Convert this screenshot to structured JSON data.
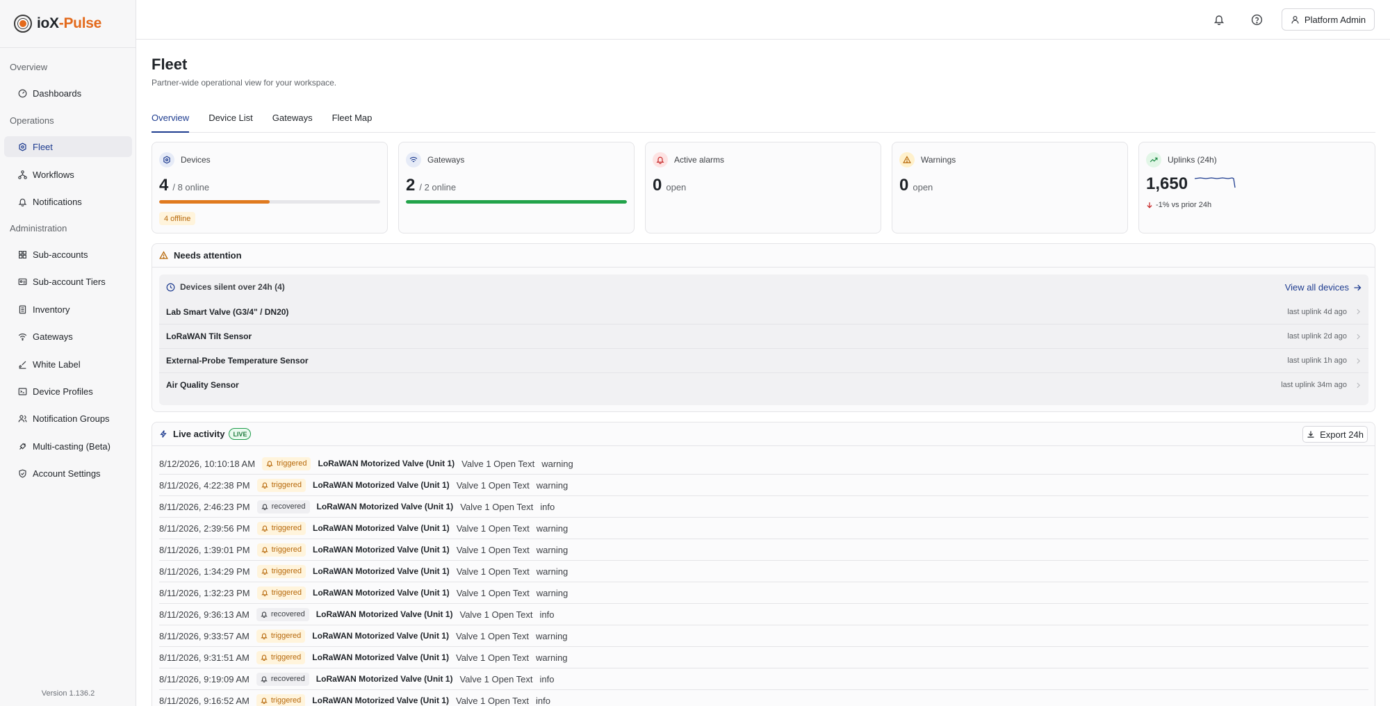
{
  "app": {
    "logo_part1": "ioX",
    "logo_part2": "-Pulse",
    "version": "Version 1.136.2"
  },
  "sidebar": {
    "sections": [
      {
        "label": "Overview"
      },
      {
        "label": "Operations"
      },
      {
        "label": "Administration"
      }
    ],
    "items": [
      {
        "label": "Dashboards",
        "icon": "gauge-icon"
      },
      {
        "label": "Fleet",
        "icon": "fleet-icon",
        "active": true
      },
      {
        "label": "Workflows",
        "icon": "workflow-icon"
      },
      {
        "label": "Notifications",
        "icon": "bell-icon"
      },
      {
        "label": "Sub-accounts",
        "icon": "grid-icon"
      },
      {
        "label": "Sub-account Tiers",
        "icon": "id-card-icon"
      },
      {
        "label": "Inventory",
        "icon": "inventory-icon"
      },
      {
        "label": "Gateways",
        "icon": "wifi-icon"
      },
      {
        "label": "White Label",
        "icon": "brush-icon"
      },
      {
        "label": "Device Profiles",
        "icon": "terminal-icon"
      },
      {
        "label": "Notification Groups",
        "icon": "users-icon"
      },
      {
        "label": "Multi-casting (Beta)",
        "icon": "broadcast-icon"
      },
      {
        "label": "Account Settings",
        "icon": "shield-check-icon"
      }
    ]
  },
  "topbar": {
    "user_label": "Platform Admin"
  },
  "page": {
    "title": "Fleet",
    "subtitle": "Partner-wide operational view for your workspace."
  },
  "tabs": [
    {
      "label": "Overview",
      "active": true
    },
    {
      "label": "Device List"
    },
    {
      "label": "Gateways"
    },
    {
      "label": "Fleet Map"
    }
  ],
  "cards": {
    "devices": {
      "title": "Devices",
      "value": "4",
      "suffix": "/ 8 online",
      "progress": 0.5,
      "badge": "4 offline",
      "color": "#e07a1f"
    },
    "gateways": {
      "title": "Gateways",
      "value": "2",
      "suffix": "/ 2 online",
      "progress": 1.0,
      "color": "#22a34a"
    },
    "alarms": {
      "title": "Active alarms",
      "value": "0",
      "suffix": "open"
    },
    "warnings": {
      "title": "Warnings",
      "value": "0",
      "suffix": "open"
    },
    "uplinks": {
      "title": "Uplinks (24h)",
      "value": "1,650",
      "trend": "-1% vs prior 24h"
    }
  },
  "attention": {
    "title": "Needs attention",
    "silent_title": "Devices silent over 24h (4)",
    "view_all": "View all devices",
    "rows": [
      {
        "name": "Lab Smart Valve (G3/4\" / DN20)",
        "last": "last uplink 4d ago"
      },
      {
        "name": "LoRaWAN Tilt Sensor",
        "last": "last uplink 2d ago"
      },
      {
        "name": "External-Probe Temperature Sensor",
        "last": "last uplink 1h ago"
      },
      {
        "name": "Air Quality Sensor",
        "last": "last uplink 34m ago"
      }
    ]
  },
  "live": {
    "title": "Live activity",
    "badge": "LIVE",
    "export": "Export 24h",
    "rows": [
      {
        "time": "8/12/2026, 10:10:18 AM",
        "status": "triggered",
        "device": "LoRaWAN Motorized Valve (Unit 1)",
        "msg": "Valve 1 Open Text",
        "sev": "warning"
      },
      {
        "time": "8/11/2026, 4:22:38 PM",
        "status": "triggered",
        "device": "LoRaWAN Motorized Valve (Unit 1)",
        "msg": "Valve 1 Open Text",
        "sev": "warning"
      },
      {
        "time": "8/11/2026, 2:46:23 PM",
        "status": "recovered",
        "device": "LoRaWAN Motorized Valve (Unit 1)",
        "msg": "Valve 1 Open Text",
        "sev": "info"
      },
      {
        "time": "8/11/2026, 2:39:56 PM",
        "status": "triggered",
        "device": "LoRaWAN Motorized Valve (Unit 1)",
        "msg": "Valve 1 Open Text",
        "sev": "warning"
      },
      {
        "time": "8/11/2026, 1:39:01 PM",
        "status": "triggered",
        "device": "LoRaWAN Motorized Valve (Unit 1)",
        "msg": "Valve 1 Open Text",
        "sev": "warning"
      },
      {
        "time": "8/11/2026, 1:34:29 PM",
        "status": "triggered",
        "device": "LoRaWAN Motorized Valve (Unit 1)",
        "msg": "Valve 1 Open Text",
        "sev": "warning"
      },
      {
        "time": "8/11/2026, 1:32:23 PM",
        "status": "triggered",
        "device": "LoRaWAN Motorized Valve (Unit 1)",
        "msg": "Valve 1 Open Text",
        "sev": "warning"
      },
      {
        "time": "8/11/2026, 9:36:13 AM",
        "status": "recovered",
        "device": "LoRaWAN Motorized Valve (Unit 1)",
        "msg": "Valve 1 Open Text",
        "sev": "info"
      },
      {
        "time": "8/11/2026, 9:33:57 AM",
        "status": "triggered",
        "device": "LoRaWAN Motorized Valve (Unit 1)",
        "msg": "Valve 1 Open Text",
        "sev": "warning"
      },
      {
        "time": "8/11/2026, 9:31:51 AM",
        "status": "triggered",
        "device": "LoRaWAN Motorized Valve (Unit 1)",
        "msg": "Valve 1 Open Text",
        "sev": "warning"
      },
      {
        "time": "8/11/2026, 9:19:09 AM",
        "status": "recovered",
        "device": "LoRaWAN Motorized Valve (Unit 1)",
        "msg": "Valve 1 Open Text",
        "sev": "info"
      },
      {
        "time": "8/11/2026, 9:16:52 AM",
        "status": "triggered",
        "device": "LoRaWAN Motorized Valve (Unit 1)",
        "msg": "Valve 1 Open Text",
        "sev": "info"
      }
    ]
  }
}
